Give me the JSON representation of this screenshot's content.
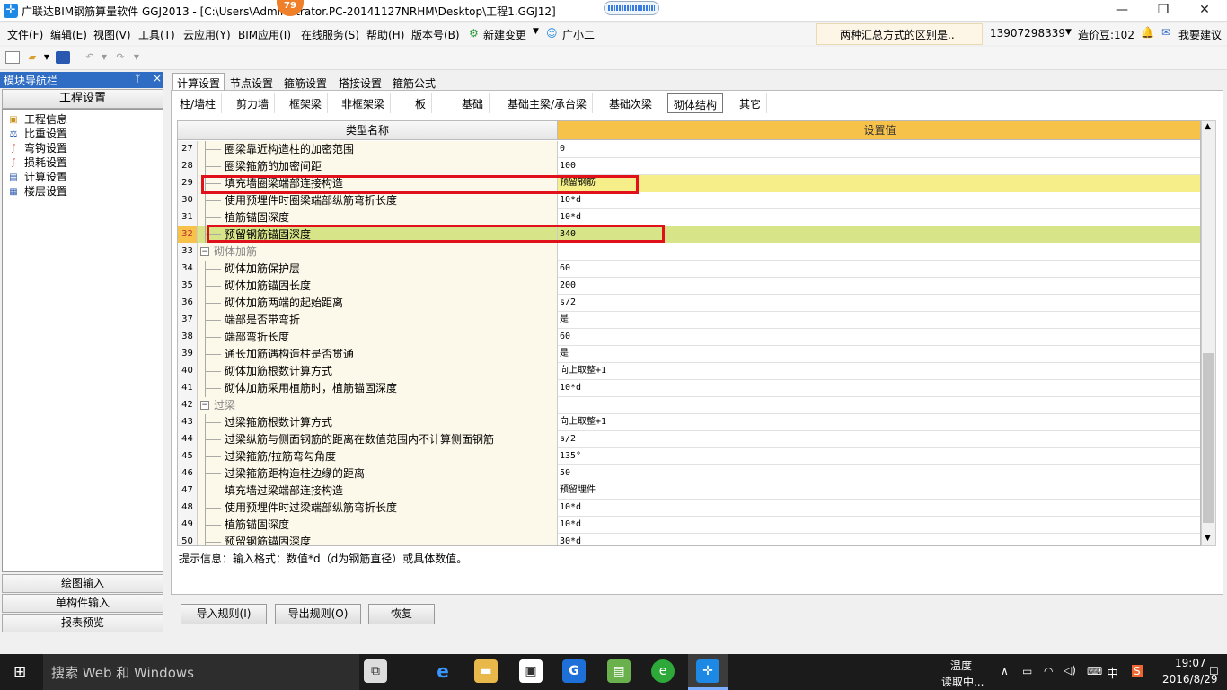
{
  "titlebar": {
    "title": "广联达BIM钢筋算量软件 GGJ2013 - [C:\\Users\\Administrator.PC-20141127NRHM\\Desktop\\工程1.GGJ12]",
    "badge": "79",
    "min": "—",
    "max": "❐",
    "close": "✕"
  },
  "menu": {
    "items": [
      "文件(F)",
      "编辑(E)",
      "视图(V)",
      "工具(T)",
      "云应用(Y)",
      "BIM应用(I)",
      "在线服务(S)",
      "帮助(H)",
      "版本号(B)",
      "新建变更",
      "广小二"
    ],
    "hint": "两种汇总方式的区别是..",
    "phone": "13907298339",
    "beans": "造价豆:102",
    "suggest": "我要建议"
  },
  "nav": {
    "title": "模块导航栏",
    "pin": "ᛘ",
    "close": "×",
    "header": "工程设置",
    "items": [
      "工程信息",
      "比重设置",
      "弯钩设置",
      "损耗设置",
      "计算设置",
      "楼层设置"
    ],
    "bottom": [
      "绘图输入",
      "单构件输入",
      "报表预览"
    ]
  },
  "tabs": [
    "计算设置",
    "节点设置",
    "箍筋设置",
    "搭接设置",
    "箍筋公式"
  ],
  "subtabs": [
    "柱/墙柱",
    "剪力墙",
    "框架梁",
    "非框架梁",
    "板",
    "基础",
    "基础主梁/承台梁",
    "基础次梁",
    "砌体结构",
    "其它"
  ],
  "grid": {
    "col_name": "类型名称",
    "col_value": "设置值",
    "rows": [
      {
        "n": "27",
        "name": "圈梁靠近构造柱的加密范围",
        "value": "0"
      },
      {
        "n": "28",
        "name": "圈梁箍筋的加密间距",
        "value": "100"
      },
      {
        "n": "29",
        "name": "填充墙圈梁端部连接构造",
        "value": "预留钢筋"
      },
      {
        "n": "30",
        "name": "使用预埋件时圈梁端部纵筋弯折长度",
        "value": "10*d"
      },
      {
        "n": "31",
        "name": "植筋锚固深度",
        "value": "10*d"
      },
      {
        "n": "32",
        "name": "预留钢筋锚固深度",
        "value": "340"
      },
      {
        "n": "33",
        "name": "砌体加筋",
        "value": "",
        "group": true
      },
      {
        "n": "34",
        "name": "砌体加筋保护层",
        "value": "60"
      },
      {
        "n": "35",
        "name": "砌体加筋锚固长度",
        "value": "200"
      },
      {
        "n": "36",
        "name": "砌体加筋两端的起始距离",
        "value": "s/2"
      },
      {
        "n": "37",
        "name": "端部是否带弯折",
        "value": "是"
      },
      {
        "n": "38",
        "name": "端部弯折长度",
        "value": "60"
      },
      {
        "n": "39",
        "name": "通长加筋遇构造柱是否贯通",
        "value": "是"
      },
      {
        "n": "40",
        "name": "砌体加筋根数计算方式",
        "value": "向上取整+1"
      },
      {
        "n": "41",
        "name": "砌体加筋采用植筋时，植筋锚固深度",
        "value": "10*d"
      },
      {
        "n": "42",
        "name": "过梁",
        "value": "",
        "group": true
      },
      {
        "n": "43",
        "name": "过梁箍筋根数计算方式",
        "value": "向上取整+1"
      },
      {
        "n": "44",
        "name": "过梁纵筋与侧面钢筋的距离在数值范围内不计算侧面钢筋",
        "value": "s/2"
      },
      {
        "n": "45",
        "name": "过梁箍筋/拉筋弯勾角度",
        "value": "135°"
      },
      {
        "n": "46",
        "name": "过梁箍筋距构造柱边缘的距离",
        "value": "50"
      },
      {
        "n": "47",
        "name": "填充墙过梁端部连接构造",
        "value": "预留埋件"
      },
      {
        "n": "48",
        "name": "使用预埋件时过梁端部纵筋弯折长度",
        "value": "10*d"
      },
      {
        "n": "49",
        "name": "植筋锚固深度",
        "value": "10*d"
      },
      {
        "n": "50",
        "name": "预留钢筋锚固深度",
        "value": "30*d"
      }
    ]
  },
  "hint": "提示信息：输入格式：数值*d（d为钢筋直径）或具体数值。",
  "buttons": {
    "import": "导入规则(I)",
    "export": "导出规则(O)",
    "restore": "恢复"
  },
  "taskbar": {
    "search": "搜索 Web 和 Windows",
    "weather_1": "温度",
    "weather_2": "读取中...",
    "lang": "中",
    "time": "19:07",
    "date": "2016/8/29"
  },
  "colors": {
    "accent": "#2f6cc4",
    "header_value": "#f6c24a",
    "highlight_row": "#d8e488",
    "red_box": "#e0111b"
  }
}
